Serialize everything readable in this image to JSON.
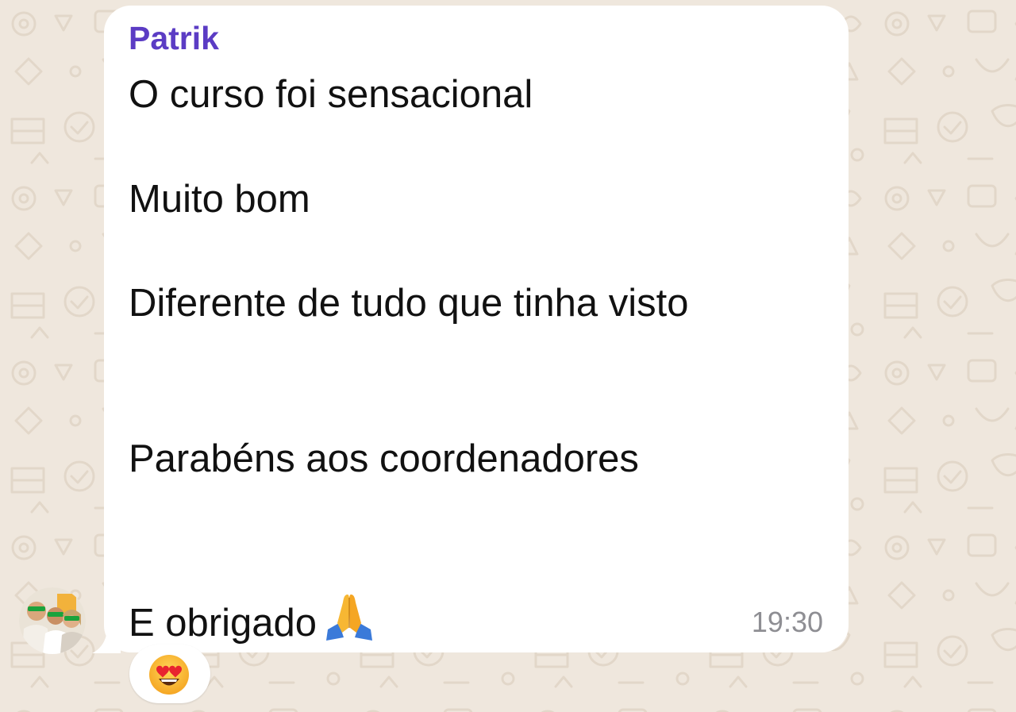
{
  "message": {
    "sender": "Patrik",
    "lines": [
      "O curso foi sensacional",
      "Muito bom",
      "Diferente de tudo que tinha visto",
      "Parabéns aos coordenadores",
      "E obrigado"
    ],
    "inline_emoji": "folded-hands-emoji",
    "time": "19:30"
  },
  "reaction": {
    "emoji": "heart-eyes-emoji"
  },
  "avatar": {
    "icon": "group-photo-avatar"
  },
  "colors": {
    "background": "#efe7dd",
    "bubble": "#ffffff",
    "sender_name": "#5b3cc4",
    "message_text": "#111111",
    "timestamp": "#8e8e93"
  }
}
